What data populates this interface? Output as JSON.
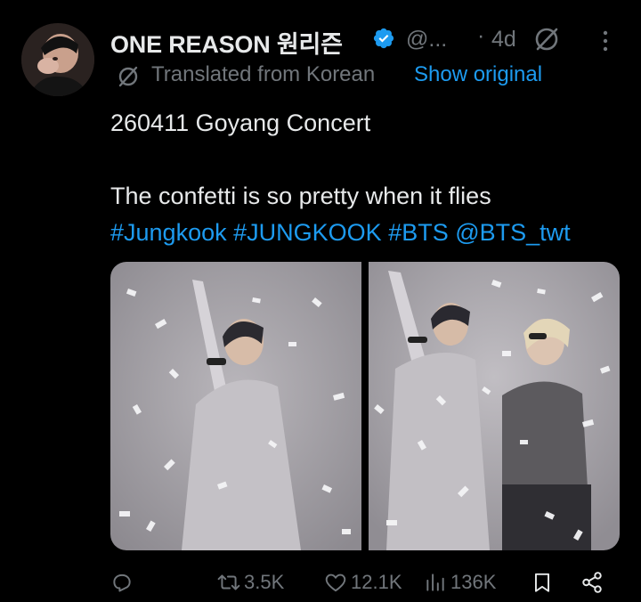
{
  "tweet": {
    "display_name": "ONE REASON 원리즌",
    "handle": "@...",
    "time_separator": "·",
    "time": "4d",
    "translated_label": "Translated from Korean",
    "show_original": "Show original",
    "text_line1": "260411 Goyang Concert",
    "text_line2": "The confetti is so pretty when it flies",
    "hashtags": [
      "#Jungkook",
      "#JUNGKOOK",
      "#BTS",
      "@BTS_twt"
    ]
  },
  "actions": {
    "retweets": "3.5K",
    "likes": "12.1K",
    "views": "136K"
  },
  "icons": {
    "verified": "verified-badge-icon",
    "grok": "grok-icon",
    "more": "more-options-icon",
    "reply": "reply-icon",
    "retweet": "retweet-icon",
    "like": "heart-icon",
    "views": "views-icon",
    "bookmark": "bookmark-icon",
    "share": "share-icon"
  },
  "colors": {
    "background": "#000000",
    "text": "#e7e9ea",
    "muted": "#71767b",
    "link": "#1d9bf0"
  }
}
